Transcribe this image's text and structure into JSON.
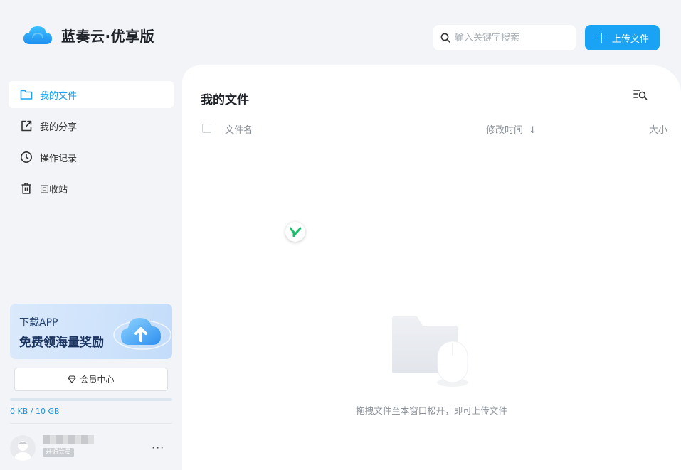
{
  "header": {
    "logo_icon": "cloud-logo-icon",
    "app_title": "蓝奏云·优享版",
    "search_placeholder": "输入关键字搜索",
    "upload_label": "上传文件"
  },
  "sidebar": {
    "items": [
      {
        "label": "我的文件",
        "icon": "folder-icon",
        "active": true
      },
      {
        "label": "我的分享",
        "icon": "share-icon",
        "active": false
      },
      {
        "label": "操作记录",
        "icon": "clock-icon",
        "active": false
      },
      {
        "label": "回收站",
        "icon": "trash-icon",
        "active": false
      }
    ],
    "promo": {
      "line1": "下载APP",
      "line2": "免费领海量奖励"
    },
    "vip_label": "会员中心",
    "storage": {
      "text": "0 KB / 10 GB",
      "used_fraction": 0
    },
    "user": {
      "badge": "开通会员",
      "more": "···"
    }
  },
  "main": {
    "title": "我的文件",
    "columns": {
      "name": "文件名",
      "modified": "修改时间",
      "sort_arrow": "↓",
      "size": "大小"
    },
    "empty_text": "拖拽文件至本窗口松开，即可上传文件"
  },
  "colors": {
    "accent": "#1aa3f4",
    "background": "#f2f4f7"
  }
}
